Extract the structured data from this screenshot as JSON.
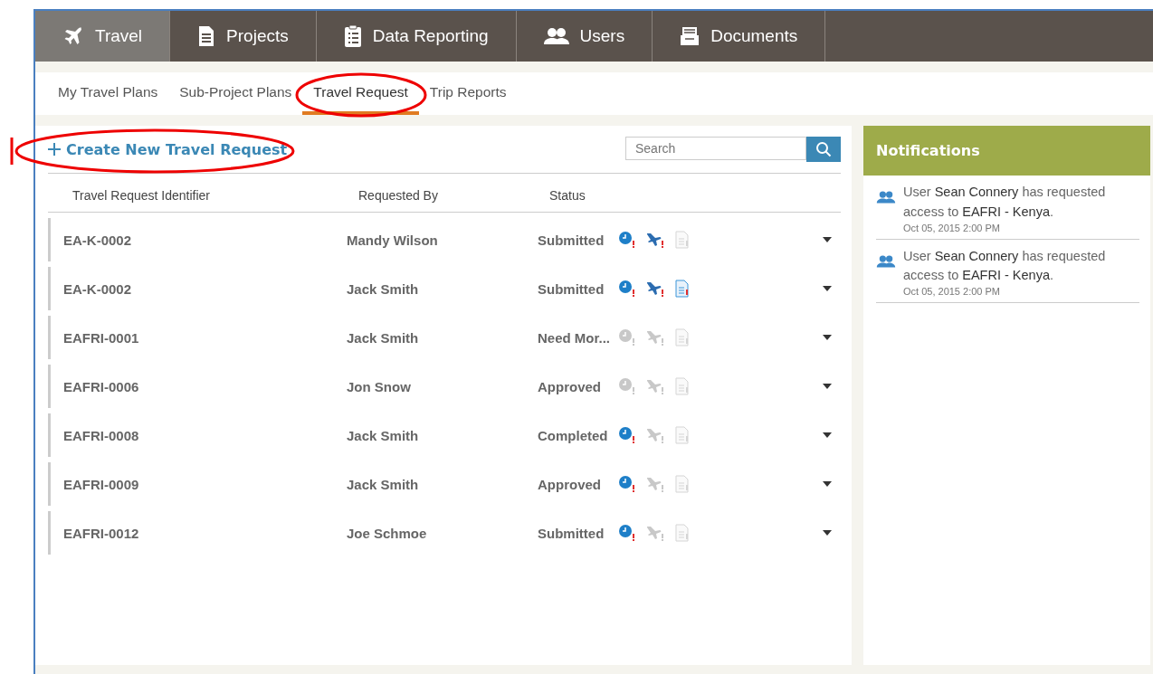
{
  "main_nav": [
    {
      "label": "Travel",
      "selected": true
    },
    {
      "label": "Projects",
      "selected": false
    },
    {
      "label": "Data Reporting",
      "selected": false
    },
    {
      "label": "Users",
      "selected": false
    },
    {
      "label": "Documents",
      "selected": false
    }
  ],
  "sub_nav": [
    {
      "label": "My Travel Plans",
      "selected": false
    },
    {
      "label": "Sub-Project Plans",
      "selected": false
    },
    {
      "label": "Travel Request",
      "selected": true
    },
    {
      "label": "Trip Reports",
      "selected": false
    }
  ],
  "create_link": "Create New Travel Request",
  "search": {
    "placeholder": "Search"
  },
  "table": {
    "columns": [
      "Travel Request Identifier",
      "Requested By",
      "Status"
    ],
    "rows": [
      {
        "id": "EA-K-0002",
        "requested_by": "Mandy Wilson",
        "status": "Submitted",
        "clock_alert": true,
        "flight_alert": true,
        "report_alert": false
      },
      {
        "id": "EA-K-0002",
        "requested_by": "Jack Smith",
        "status": "Submitted",
        "clock_alert": true,
        "flight_alert": true,
        "report_alert": true
      },
      {
        "id": "EAFRI-0001",
        "requested_by": "Jack Smith",
        "status": "Need Mor...",
        "clock_alert": false,
        "flight_alert": false,
        "report_alert": false
      },
      {
        "id": "EAFRI-0006",
        "requested_by": "Jon Snow",
        "status": "Approved",
        "clock_alert": false,
        "flight_alert": false,
        "report_alert": false
      },
      {
        "id": "EAFRI-0008",
        "requested_by": "Jack Smith",
        "status": "Completed",
        "clock_alert": true,
        "flight_alert": false,
        "report_alert": false
      },
      {
        "id": "EAFRI-0009",
        "requested_by": "Jack Smith",
        "status": "Approved",
        "clock_alert": true,
        "flight_alert": false,
        "report_alert": false
      },
      {
        "id": "EAFRI-0012",
        "requested_by": "Joe Schmoe",
        "status": "Submitted",
        "clock_alert": true,
        "flight_alert": false,
        "report_alert": false
      }
    ]
  },
  "notifications": {
    "title": "Notifications",
    "items": [
      {
        "parts": [
          {
            "text": "User ",
            "highlight": false
          },
          {
            "text": "Sean Connery",
            "highlight": true
          },
          {
            "text": " has requested access to ",
            "highlight": false
          },
          {
            "text": "EAFRI - Kenya",
            "highlight": true
          },
          {
            "text": ".",
            "highlight": false
          }
        ],
        "time": "Oct 05, 2015 2:00 PM"
      },
      {
        "parts": [
          {
            "text": "User ",
            "highlight": false
          },
          {
            "text": "Sean Connery",
            "highlight": true
          },
          {
            "text": " has requested access to ",
            "highlight": false
          },
          {
            "text": "EAFRI - Kenya",
            "highlight": true
          },
          {
            "text": ".",
            "highlight": false
          }
        ],
        "time": "Oct 05, 2015 2:00 PM"
      }
    ]
  }
}
